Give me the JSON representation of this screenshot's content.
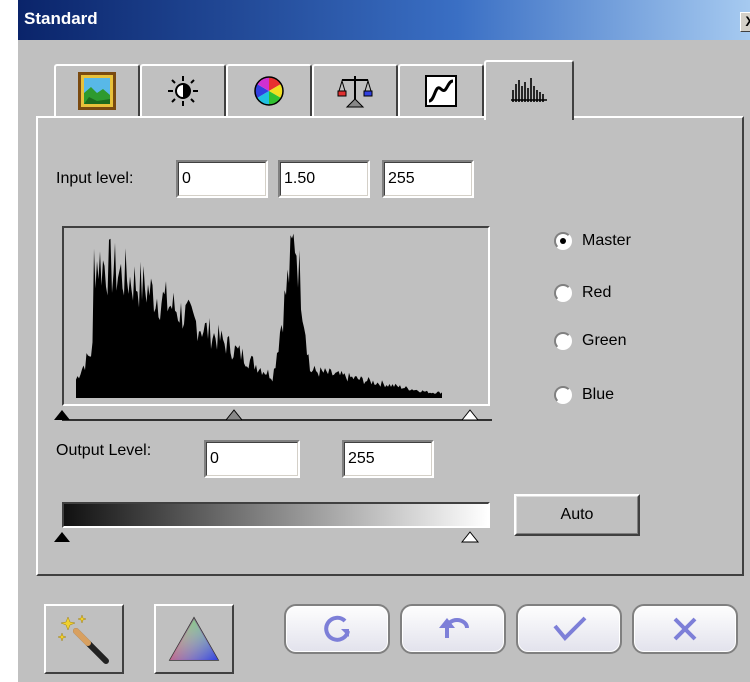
{
  "window": {
    "title": "Standard",
    "close_glyph": "X"
  },
  "tabs": [
    {
      "icon": "landscape-icon",
      "active": false
    },
    {
      "icon": "brightness-icon",
      "active": false
    },
    {
      "icon": "color-wheel-icon",
      "active": false
    },
    {
      "icon": "balance-icon",
      "active": false
    },
    {
      "icon": "curve-icon",
      "active": false
    },
    {
      "icon": "histogram-icon",
      "active": true
    }
  ],
  "levels": {
    "input_label": "Input level:",
    "input_black": "0",
    "input_gamma": "1.50",
    "input_white": "255",
    "output_label": "Output Level:",
    "output_black": "0",
    "output_white": "255",
    "auto_label": "Auto"
  },
  "channels": [
    {
      "label": "Master",
      "selected": true
    },
    {
      "label": "Red",
      "selected": false
    },
    {
      "label": "Green",
      "selected": false
    },
    {
      "label": "Blue",
      "selected": false
    }
  ],
  "bottom_buttons": [
    {
      "icon": "magic-wand-icon"
    },
    {
      "icon": "rgb-triangle-icon"
    },
    {
      "icon": "reset-icon"
    },
    {
      "icon": "undo-icon"
    },
    {
      "icon": "ok-check-icon"
    },
    {
      "icon": "cancel-x-icon"
    }
  ],
  "colors": {
    "title_start": "#0a246a",
    "title_end": "#a6caf0",
    "face": "#c0c0c0",
    "pill_icon": "#7d7fd8"
  }
}
